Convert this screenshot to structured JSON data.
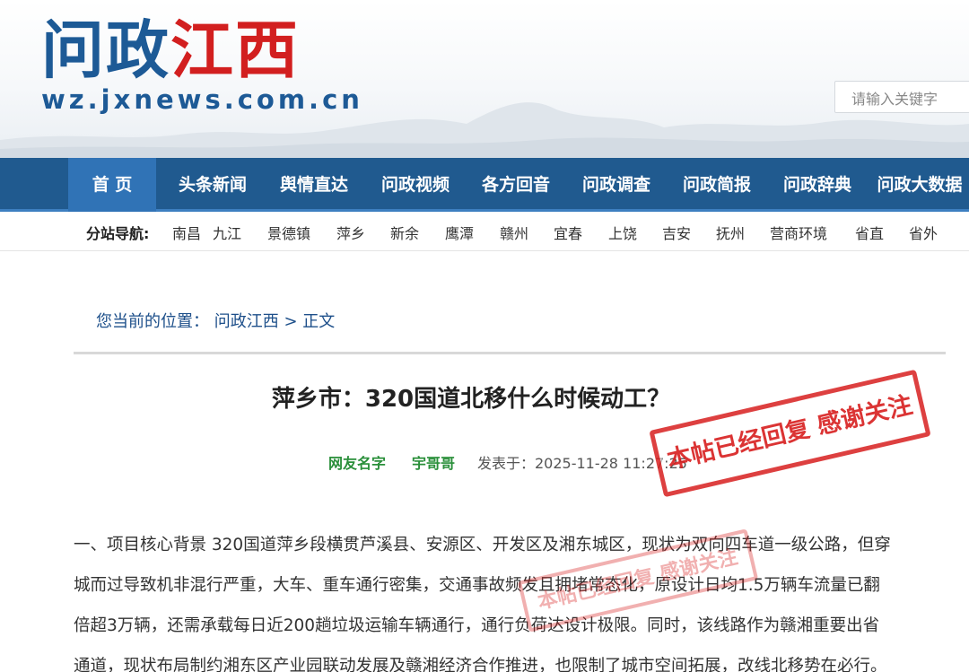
{
  "header": {
    "logo_part1": "问政",
    "logo_part2": "江西",
    "logo_url": "wz.jxnews.com.cn",
    "search_placeholder": "请输入关键字"
  },
  "nav": {
    "items": [
      "首 页",
      "头条新闻",
      "舆情直达",
      "问政视频",
      "各方回音",
      "问政调查",
      "问政简报",
      "问政辞典",
      "问政大数据"
    ]
  },
  "subnav": {
    "title": "分站导航:",
    "items": [
      "南昌",
      "九江",
      "景德镇",
      "萍乡",
      "新余",
      "鹰潭",
      "赣州",
      "宜春",
      "上饶",
      "吉安",
      "抚州",
      "营商环境",
      "省直",
      "省外"
    ]
  },
  "breadcrumb": {
    "label": "您当前的位置：",
    "site": "问政江西",
    "separator": ">",
    "current": "正文"
  },
  "article": {
    "title": "萍乡市：320国道北移什么时候动工？",
    "meta_label": "网友名字",
    "author": "宇哥哥",
    "date": "发表于：2025-11-28 11:27:25",
    "lines": [
      "一、项目核心背景 320国道萍乡段横贯芦溪县、安源区、开发区及湘东城区，现状为双向四车道一级公路，但穿",
      "城而过导致机非混行严重，大车、重车通行密集，交通事故频发且拥堵常态化，原设计日均1.5万辆车流量已翻",
      "倍超3万辆，还需承载每日近200趟垃圾运输车辆通行，通行负荷达设计极限。同时，该线路作为赣湘重要出省",
      "通道，现状布局制约湘东区产业园联动发展及赣湘经济合作推进，也限制了城市空间拓展，改线北移势在必行。"
    ],
    "stamp_text": "本帖已经回复 感谢关注",
    "stamp_text_faded": "本帖已经回复 感谢关注"
  },
  "colors": {
    "nav_bg": "#205a8f",
    "nav_active": "#3073b6",
    "logo_blue": "#1d5a96",
    "logo_red": "#d21f1f",
    "stamp_red": "#d71e1e",
    "meta_green": "#2a8f3a"
  }
}
